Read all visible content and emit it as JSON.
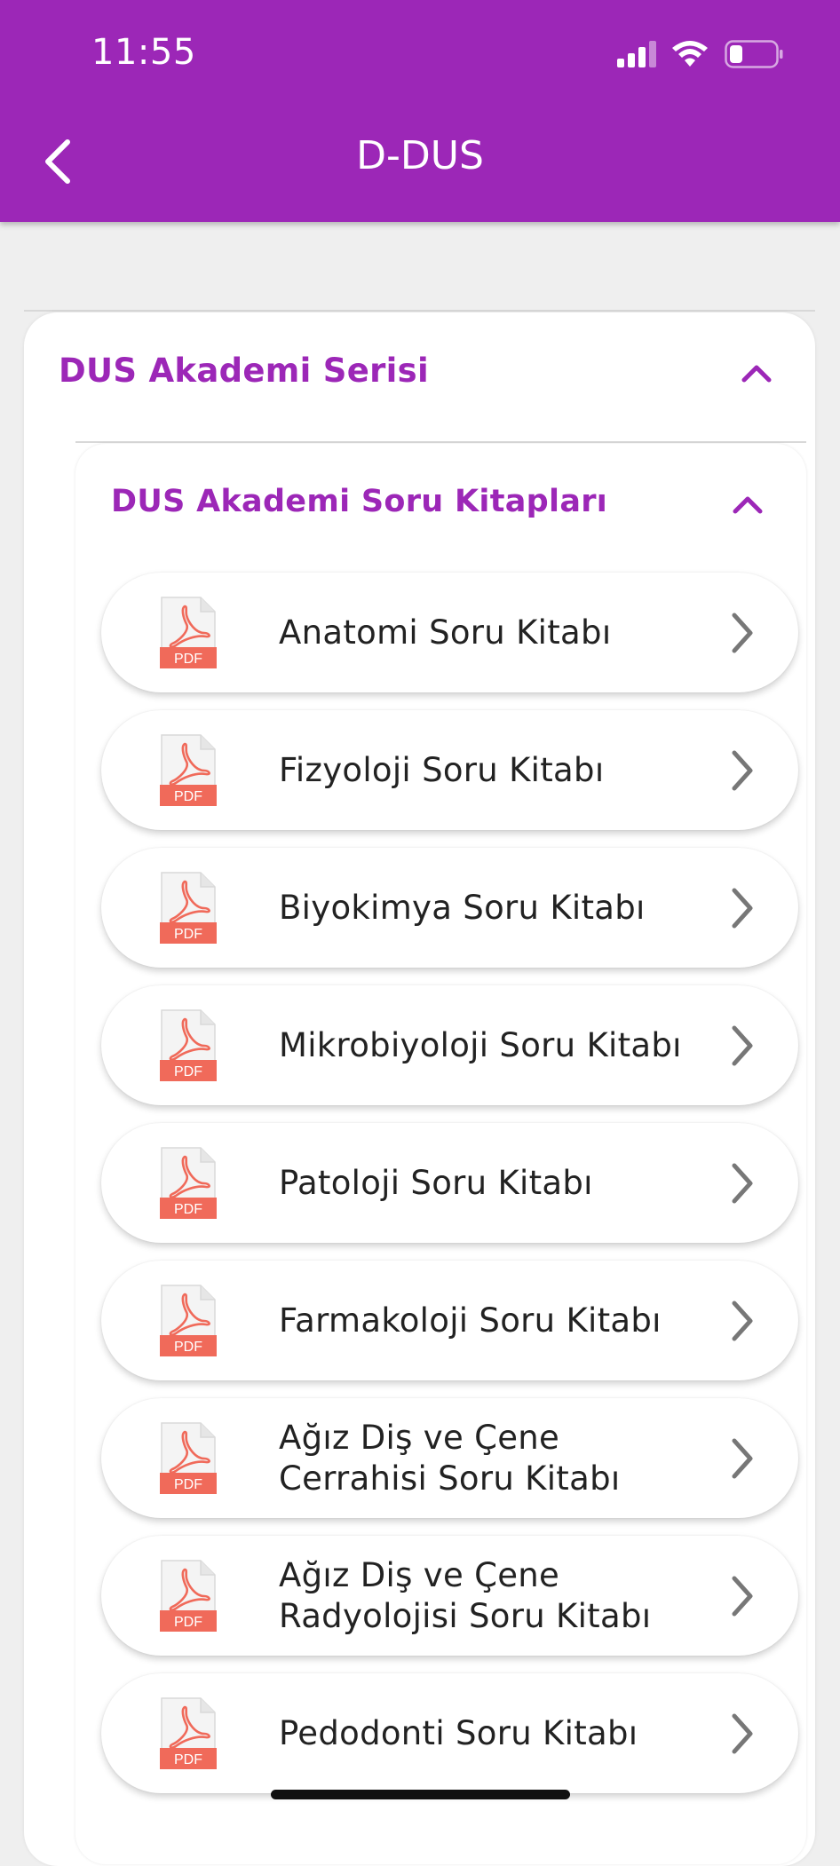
{
  "status_bar": {
    "time": "11:55"
  },
  "header": {
    "title": "D-DUS",
    "background": "#9c27b7"
  },
  "accordion": {
    "title": "DUS Akademi Serisi",
    "sub": {
      "title": "DUS Akademi Soru Kitapları",
      "items": [
        {
          "icon": "pdf-icon",
          "badge": "PDF",
          "label": "Anatomi Soru Kitabı"
        },
        {
          "icon": "pdf-icon",
          "badge": "PDF",
          "label": "Fizyoloji Soru Kitabı"
        },
        {
          "icon": "pdf-icon",
          "badge": "PDF",
          "label": "Biyokimya Soru Kitabı"
        },
        {
          "icon": "pdf-icon",
          "badge": "PDF",
          "label": "Mikrobiyoloji Soru Kitabı"
        },
        {
          "icon": "pdf-icon",
          "badge": "PDF",
          "label": "Patoloji Soru Kitabı"
        },
        {
          "icon": "pdf-icon",
          "badge": "PDF",
          "label": "Farmakoloji Soru Kitabı"
        },
        {
          "icon": "pdf-icon",
          "badge": "PDF",
          "label": "Ağız Diş ve Çene Cerrahisi Soru Kitabı"
        },
        {
          "icon": "pdf-icon",
          "badge": "PDF",
          "label": "Ağız Diş ve Çene Radyolojisi Soru Kitabı"
        },
        {
          "icon": "pdf-icon",
          "badge": "PDF",
          "label": "Pedodonti Soru Kitabı"
        }
      ]
    }
  },
  "colors": {
    "accent": "#9c27b7",
    "pdf_red": "#f06a5a",
    "text": "#222222",
    "chevron": "#777777"
  }
}
